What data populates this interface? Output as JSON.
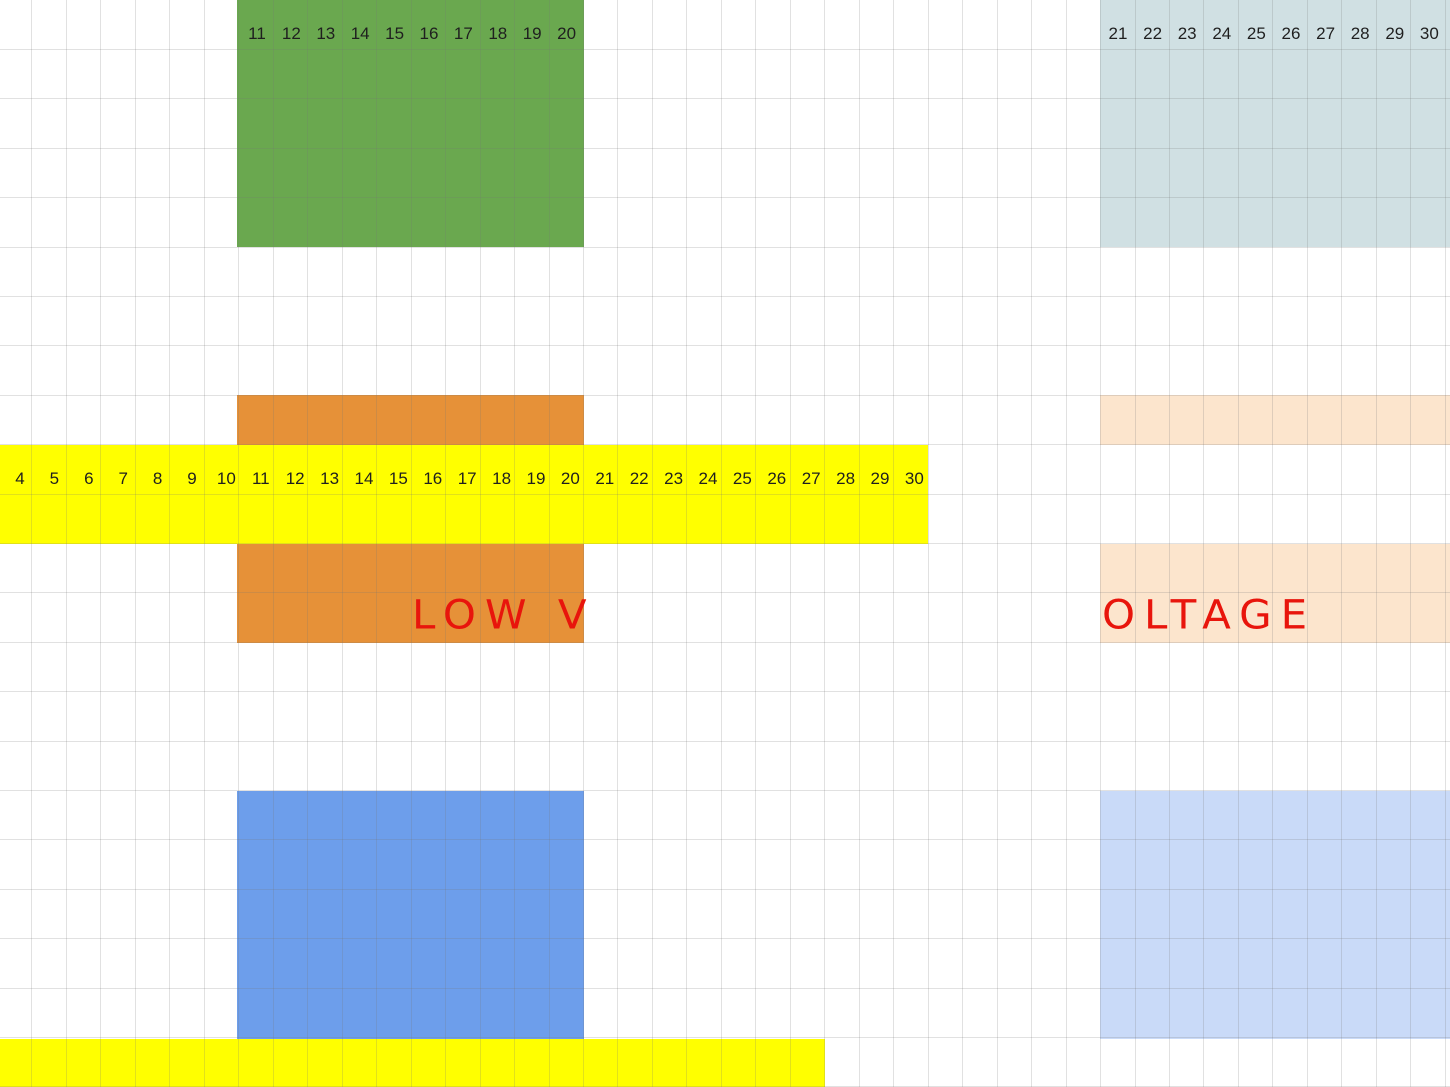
{
  "spreadsheet": {
    "row_labels_top_green": [
      "11",
      "12",
      "13",
      "14",
      "15",
      "16",
      "17",
      "18",
      "19",
      "20"
    ],
    "row_labels_top_gray": [
      "21",
      "22",
      "23",
      "24",
      "25",
      "26",
      "27",
      "28",
      "29",
      "30"
    ],
    "row_labels_yellow": [
      "4",
      "5",
      "6",
      "7",
      "8",
      "9",
      "10",
      "11",
      "12",
      "13",
      "14",
      "15",
      "16",
      "17",
      "18",
      "19",
      "20",
      "21",
      "22",
      "23",
      "24",
      "25",
      "26",
      "27",
      "28",
      "29",
      "30"
    ],
    "annotation_left": "LOW V",
    "annotation_right": "OLTAGE"
  },
  "colors": {
    "green": "#6aa84f",
    "gray_blue": "#d0e0e3",
    "orange": "#e69138",
    "light_orange": "#fce5cd",
    "yellow": "#ffff00",
    "blue": "#6d9eeb",
    "light_blue": "#c9daf8",
    "annotation": "#e8150c"
  }
}
